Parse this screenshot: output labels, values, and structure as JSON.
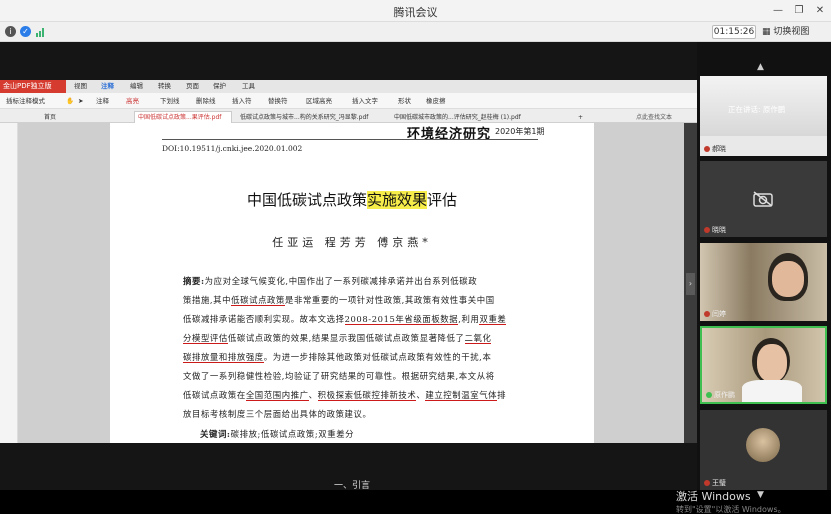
{
  "window": {
    "title": "腾讯会议"
  },
  "meeting": {
    "timer": "01:15:26",
    "switch_view": "切换视图",
    "speaking": "正在讲话: 原作鹏"
  },
  "pdf_app": {
    "brand": "金山PDF独立版",
    "menu": [
      "视图",
      "注释",
      "编辑",
      "转换",
      "页面",
      "保护",
      "工具"
    ],
    "ribbon": [
      "插标注释模式",
      "注释",
      "高亮",
      "下划线",
      "删除线",
      "插入符",
      "替换符",
      "区域高亮",
      "插入文字",
      "形状",
      "橡皮擦"
    ],
    "search_label": "点此查找文本",
    "tabs": [
      {
        "label": "首页"
      },
      {
        "label": "中国低碳试点政策...果评估.pdf"
      },
      {
        "label": "低碳试点政策与城市...构的关系研究_冯显黎.pdf"
      },
      {
        "label": "中国低碳城市政策的...评估研究_赵桂梅 (1).pdf"
      }
    ]
  },
  "document": {
    "journal": "环境经济研究",
    "issue": "2020年第1期",
    "doi": "DOI:10.19511/j.cnki.jee.2020.01.002",
    "title_pre": "中国低碳试点政策",
    "title_hl": "实施效果",
    "title_post": "评估",
    "authors": "任亚运 程芳芳 傅京燕*",
    "abstract": {
      "l1_label": "摘要:",
      "l1": "为应对全球气候变化,中国作出了一系列碳减排承诺并出台系列低碳政",
      "l2a": "策措施,其中",
      "l2u": "低碳试点政策",
      "l2b": "是非常重要的一项针对性政策,其政策有效性事关中国",
      "l3a": "低碳减排承诺能否顺利实现。故本文选择",
      "l3u": "2008-2015年省级面板数据",
      "l3b": ",利用",
      "l3u2": "双重差",
      "l4u": "分模型评估",
      "l4a": "低碳试点政策的效果,结果显示我国低碳试点政策显著降低了",
      "l4u2": "二氧化",
      "l5u": "碳排放量和排放强度",
      "l5a": "。为进一步排除其他政策对低碳试点政策有效性的干扰,本",
      "l6": "文做了一系列稳健性检验,均验证了研究结果的可靠性。根据研究结果,本文从将",
      "l7a": "低碳试点政策在",
      "l7u": "全国范围内推广",
      "l7b": "、",
      "l7u2": "积极探索低碳控排新技术",
      "l7c": "、",
      "l7u3": "建立控制温室气体",
      "l7d": "排",
      "l8": "放目标考核制度三个层面给出具体的政策建议。",
      "kw_label": "关键词:",
      "kw": "碳排放;低碳试点政策;双重差分"
    },
    "section": "一、引言"
  },
  "participants": [
    {
      "name": "郝晓"
    },
    {
      "name": "晓晓"
    },
    {
      "name": "闫婷"
    },
    {
      "name": "原作鹏"
    },
    {
      "name": "王璧"
    }
  ],
  "watermark": {
    "line1": "激活 Windows",
    "line2": "转到\"设置\"以激活 Windows。"
  },
  "colors": {
    "brand_red": "#d53b2f",
    "highlight": "#f6ec4a",
    "underline": "#cc1a1a"
  }
}
